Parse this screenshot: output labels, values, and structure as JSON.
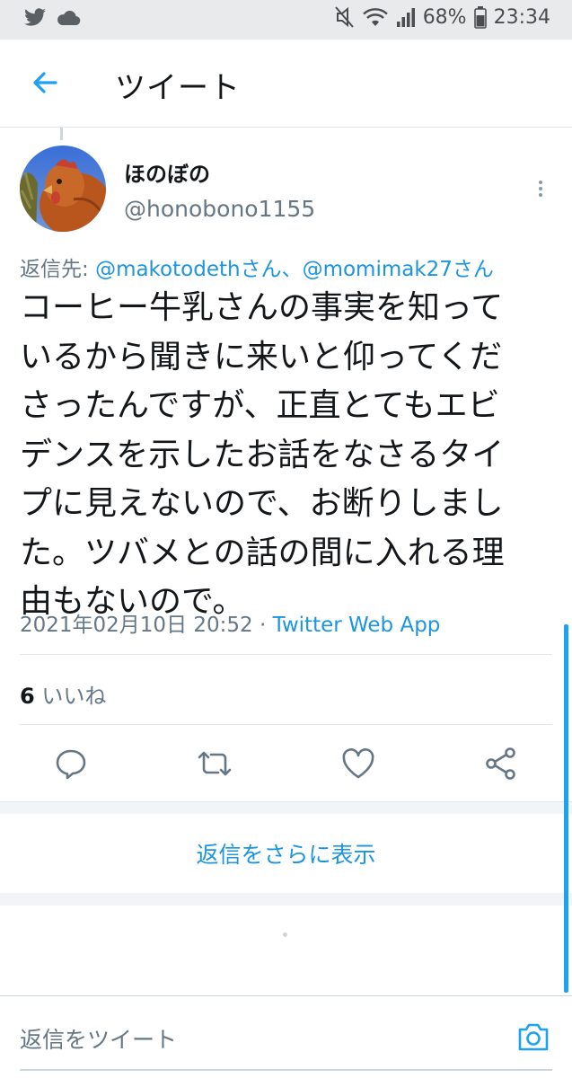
{
  "status_bar": {
    "battery": "68%",
    "time": "23:34",
    "left_icons": [
      "twitter-icon",
      "cloud-icon"
    ],
    "right_icons": [
      "mute-icon",
      "wifi-icon",
      "signal-icon",
      "battery-icon"
    ]
  },
  "header": {
    "title": "ツイート",
    "back_icon": "arrow-left-icon"
  },
  "tweet": {
    "author_name": "ほのぼの",
    "author_handle": "@honobono1155",
    "reply_prefix": "返信先: ",
    "reply_mentions": "@makotodethさん、@momimak27さん",
    "text_lines": [
      "コーヒー牛乳さんの事実を知って",
      "いるから聞きに来いと仰ってくだ",
      "さったんですが、正直とてもエビ",
      "デンスを示したお話をなさるタイ",
      "プに見えないので、お断りしまし",
      "た。ツバメとの話の間に入れる理",
      "由もないので。"
    ],
    "timestamp": "2021年02月10日 20:52",
    "separator": " · ",
    "source_app": "Twitter Web App",
    "like_count": "6",
    "like_label": " いいね"
  },
  "actions": [
    "reply-icon",
    "retweet-icon",
    "like-icon",
    "share-icon"
  ],
  "more_replies": "返信をさらに表示",
  "composer": {
    "placeholder": "返信をツイート",
    "camera_icon": "camera-icon"
  },
  "colors": {
    "accent": "#1b95e0",
    "muted": "#657786",
    "text": "#14171a",
    "statusbar_bg": "#e9eaeb"
  }
}
